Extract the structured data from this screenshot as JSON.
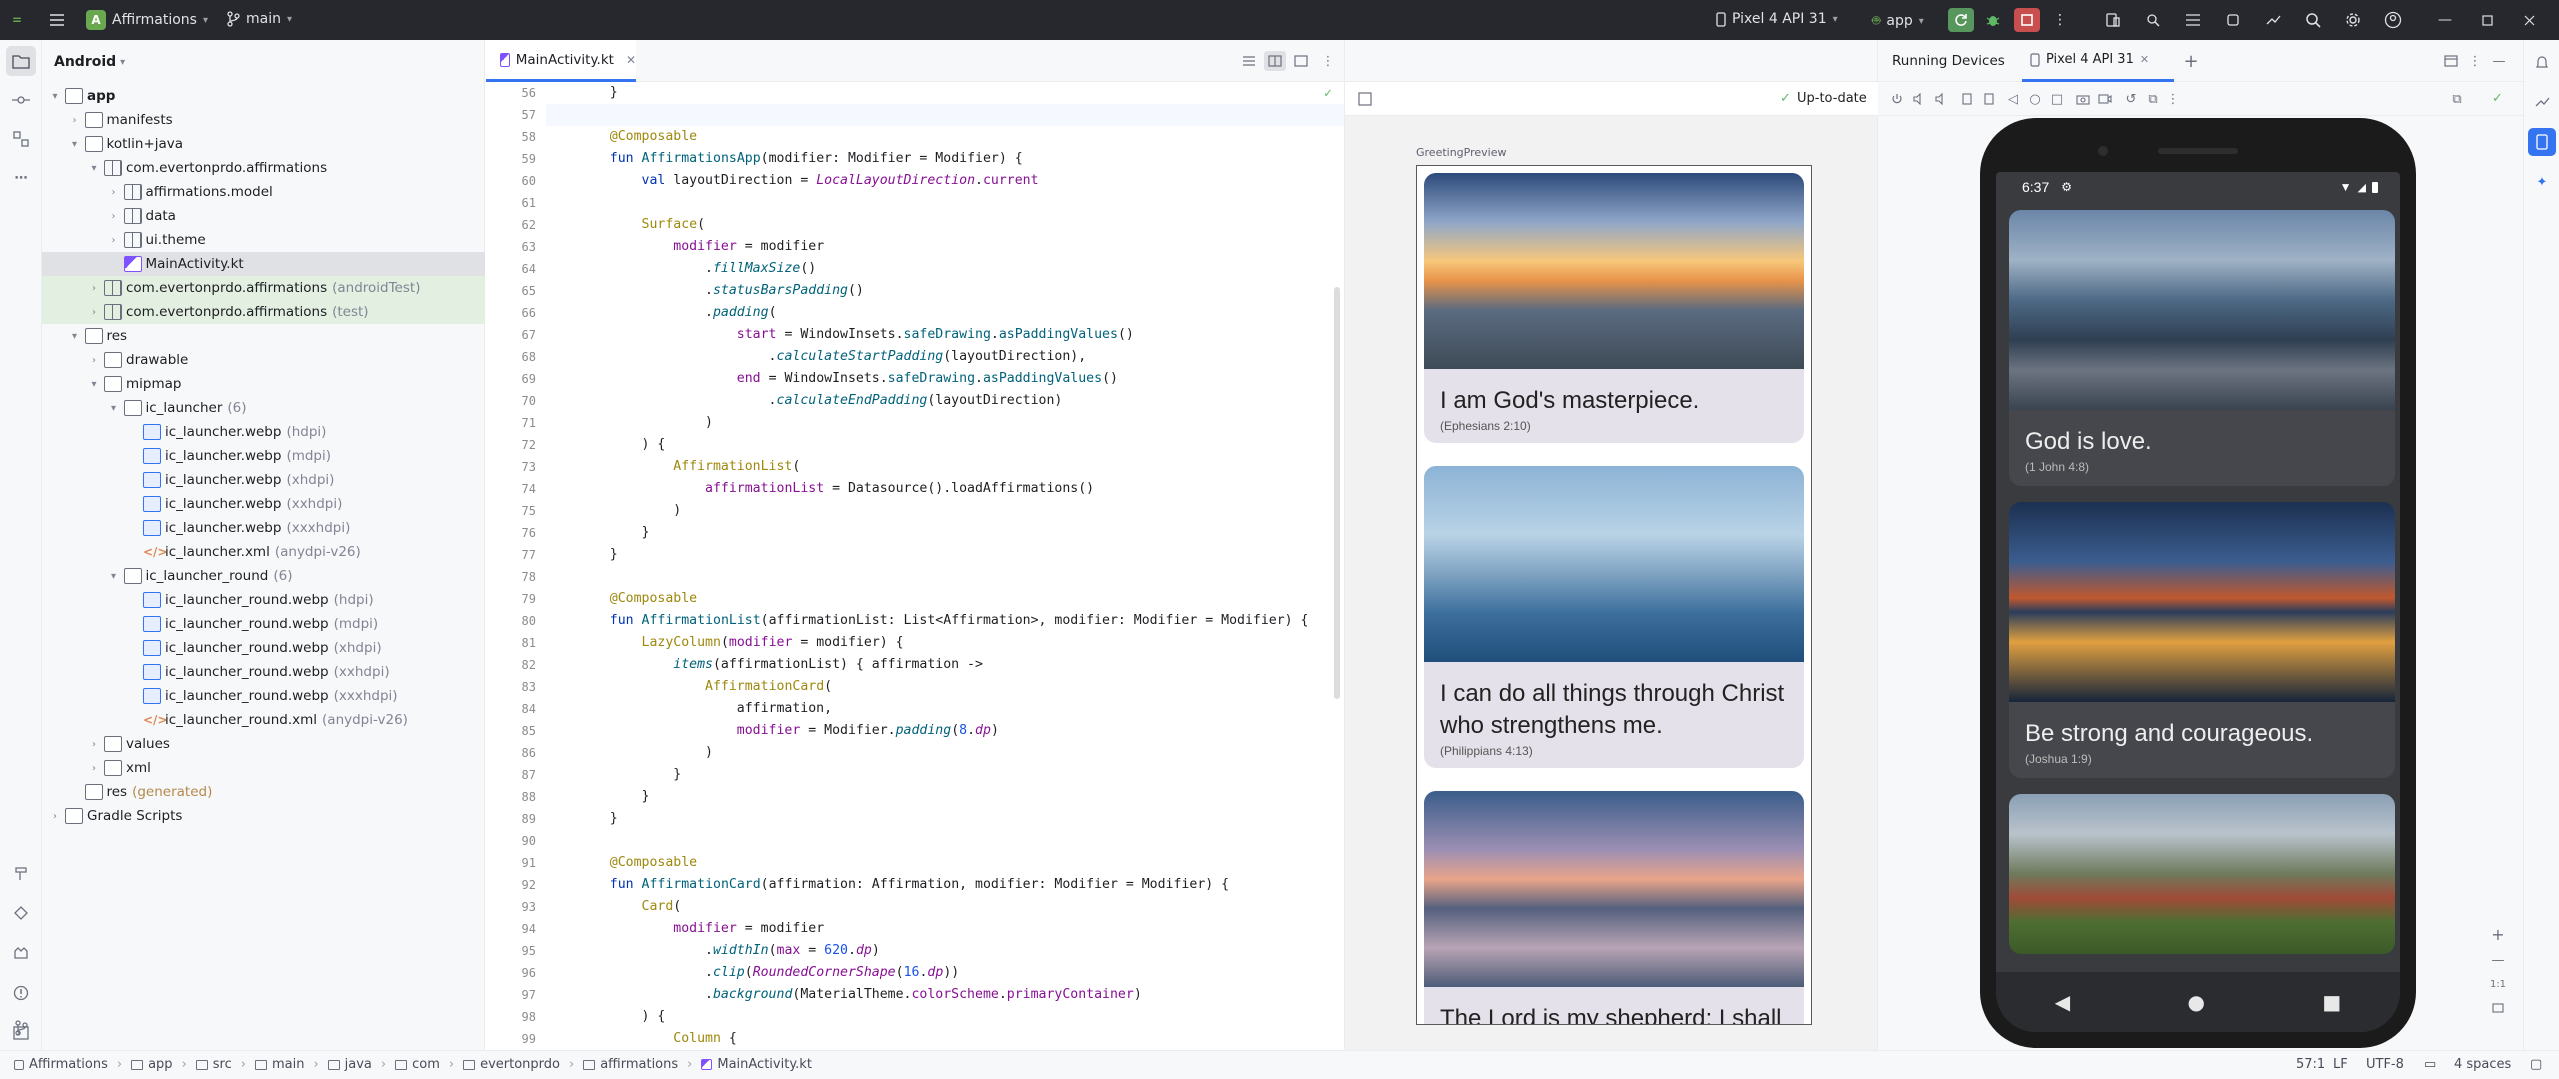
{
  "titlebar": {
    "project_initial": "A",
    "project": "Affirmations",
    "branch": "main",
    "device": "Pixel 4 API 31",
    "run_config": "app"
  },
  "project_view": {
    "mode": "Android",
    "tree": [
      {
        "label": "app",
        "suffix": "",
        "depth": 0,
        "arrow": "▾",
        "icon": "folder",
        "bold": true
      },
      {
        "label": "manifests",
        "suffix": "",
        "depth": 1,
        "arrow": "›",
        "icon": "folder"
      },
      {
        "label": "kotlin+java",
        "suffix": "",
        "depth": 1,
        "arrow": "▾",
        "icon": "folder"
      },
      {
        "label": "com.evertonprdo.affirmations",
        "suffix": "",
        "depth": 2,
        "arrow": "▾",
        "icon": "pkg"
      },
      {
        "label": "affirmations.model",
        "suffix": "",
        "depth": 3,
        "arrow": "›",
        "icon": "pkg"
      },
      {
        "label": "data",
        "suffix": "",
        "depth": 3,
        "arrow": "›",
        "icon": "pkg"
      },
      {
        "label": "ui.theme",
        "suffix": "",
        "depth": 3,
        "arrow": "›",
        "icon": "pkg"
      },
      {
        "label": "MainActivity.kt",
        "suffix": "",
        "depth": 3,
        "arrow": "",
        "icon": "kt",
        "selected": true
      },
      {
        "label": "com.evertonprdo.affirmations",
        "suffix": "(androidTest)",
        "depth": 2,
        "arrow": "›",
        "icon": "pkg",
        "green": true
      },
      {
        "label": "com.evertonprdo.affirmations",
        "suffix": "(test)",
        "depth": 2,
        "arrow": "›",
        "icon": "pkg",
        "green": true
      },
      {
        "label": "res",
        "suffix": "",
        "depth": 1,
        "arrow": "▾",
        "icon": "folder"
      },
      {
        "label": "drawable",
        "suffix": "",
        "depth": 2,
        "arrow": "›",
        "icon": "folder"
      },
      {
        "label": "mipmap",
        "suffix": "",
        "depth": 2,
        "arrow": "▾",
        "icon": "folder"
      },
      {
        "label": "ic_launcher",
        "suffix": "(6)",
        "depth": 3,
        "arrow": "▾",
        "icon": "folder"
      },
      {
        "label": "ic_launcher.webp",
        "suffix": "(hdpi)",
        "depth": 4,
        "arrow": "",
        "icon": "webp"
      },
      {
        "label": "ic_launcher.webp",
        "suffix": "(mdpi)",
        "depth": 4,
        "arrow": "",
        "icon": "webp"
      },
      {
        "label": "ic_launcher.webp",
        "suffix": "(xhdpi)",
        "depth": 4,
        "arrow": "",
        "icon": "webp"
      },
      {
        "label": "ic_launcher.webp",
        "suffix": "(xxhdpi)",
        "depth": 4,
        "arrow": "",
        "icon": "webp"
      },
      {
        "label": "ic_launcher.webp",
        "suffix": "(xxxhdpi)",
        "depth": 4,
        "arrow": "",
        "icon": "webp"
      },
      {
        "label": "ic_launcher.xml",
        "suffix": "(anydpi-v26)",
        "depth": 4,
        "arrow": "",
        "icon": "xml"
      },
      {
        "label": "ic_launcher_round",
        "suffix": "(6)",
        "depth": 3,
        "arrow": "▾",
        "icon": "folder"
      },
      {
        "label": "ic_launcher_round.webp",
        "suffix": "(hdpi)",
        "depth": 4,
        "arrow": "",
        "icon": "webp"
      },
      {
        "label": "ic_launcher_round.webp",
        "suffix": "(mdpi)",
        "depth": 4,
        "arrow": "",
        "icon": "webp"
      },
      {
        "label": "ic_launcher_round.webp",
        "suffix": "(xhdpi)",
        "depth": 4,
        "arrow": "",
        "icon": "webp"
      },
      {
        "label": "ic_launcher_round.webp",
        "suffix": "(xxhdpi)",
        "depth": 4,
        "arrow": "",
        "icon": "webp"
      },
      {
        "label": "ic_launcher_round.webp",
        "suffix": "(xxxhdpi)",
        "depth": 4,
        "arrow": "",
        "icon": "webp"
      },
      {
        "label": "ic_launcher_round.xml",
        "suffix": "(anydpi-v26)",
        "depth": 4,
        "arrow": "",
        "icon": "xml"
      },
      {
        "label": "values",
        "suffix": "",
        "depth": 2,
        "arrow": "›",
        "icon": "folder"
      },
      {
        "label": "xml",
        "suffix": "",
        "depth": 2,
        "arrow": "›",
        "icon": "folder"
      },
      {
        "label": "res",
        "suffix": "(generated)",
        "depth": 1,
        "arrow": "",
        "icon": "folder"
      },
      {
        "label": "Gradle Scripts",
        "suffix": "",
        "depth": 0,
        "arrow": "›",
        "icon": "gradle"
      }
    ]
  },
  "editor": {
    "tab": "MainActivity.kt",
    "lines": [
      {
        "n": "56",
        "html": "    }"
      },
      {
        "n": "57",
        "html": ""
      },
      {
        "n": "58",
        "html": "    <span class=\"an\">@Composable</span>"
      },
      {
        "n": "59",
        "html": "    <span class=\"kw\">fun</span> <span class=\"fn\">AffirmationsApp</span>(modifier: Modifier = Modifier) {"
      },
      {
        "n": "60",
        "html": "        <span class=\"kw\">val</span> layoutDirection = <span class=\"pp\">LocalLayoutDirection</span>.<span class=\"nm2\">current</span>"
      },
      {
        "n": "61",
        "html": ""
      },
      {
        "n": "62",
        "html": "        <span class=\"an\">Surface</span>("
      },
      {
        "n": "63",
        "html": "            <span class=\"pm\">modifier</span> = modifier"
      },
      {
        "n": "64",
        "html": "                .<span class=\"it\">fillMaxSize</span>()"
      },
      {
        "n": "65",
        "html": "                .<span class=\"it\">statusBarsPadding</span>()"
      },
      {
        "n": "66",
        "html": "                .<span class=\"it\">padding</span>("
      },
      {
        "n": "67",
        "html": "                    <span class=\"pm\">start</span> = WindowInsets.<span class=\"fn\">safeDrawing</span>.<span class=\"fn\">asPaddingValues</span>()"
      },
      {
        "n": "68",
        "html": "                        .<span class=\"it\">calculateStartPadding</span>(layoutDirection),"
      },
      {
        "n": "69",
        "html": "                    <span class=\"pm\">end</span> = WindowInsets.<span class=\"fn\">safeDrawing</span>.<span class=\"fn\">asPaddingValues</span>()"
      },
      {
        "n": "70",
        "html": "                        .<span class=\"it\">calculateEndPadding</span>(layoutDirection)"
      },
      {
        "n": "71",
        "html": "                )"
      },
      {
        "n": "72",
        "html": "        ) {"
      },
      {
        "n": "73",
        "html": "            <span class=\"an\">AffirmationList</span>("
      },
      {
        "n": "74",
        "html": "                <span class=\"pm\">affirmationList</span> = Datasource().loadAffirmations()"
      },
      {
        "n": "75",
        "html": "            )"
      },
      {
        "n": "76",
        "html": "        }"
      },
      {
        "n": "77",
        "html": "    }"
      },
      {
        "n": "78",
        "html": ""
      },
      {
        "n": "79",
        "html": "    <span class=\"an\">@Composable</span>"
      },
      {
        "n": "80",
        "html": "    <span class=\"kw\">fun</span> <span class=\"fn\">AffirmationList</span>(affirmationList: List&lt;Affirmation&gt;, modifier: Modifier = Modifier) {"
      },
      {
        "n": "81",
        "html": "        <span class=\"an\">LazyColumn</span>(<span class=\"pm\">modifier</span> = modifier) {"
      },
      {
        "n": "82",
        "html": "            <span class=\"it\">items</span>(affirmationList) { affirmation -&gt;"
      },
      {
        "n": "83",
        "html": "                <span class=\"an\">AffirmationCard</span>("
      },
      {
        "n": "84",
        "html": "                    affirmation,"
      },
      {
        "n": "85",
        "html": "                    <span class=\"pm\">modifier</span> = Modifier.<span class=\"it\">padding</span>(<span class=\"nm\">8</span>.<span class=\"pp\">dp</span>)"
      },
      {
        "n": "86",
        "html": "                )"
      },
      {
        "n": "87",
        "html": "            }"
      },
      {
        "n": "88",
        "html": "        }"
      },
      {
        "n": "89",
        "html": "    }"
      },
      {
        "n": "90",
        "html": ""
      },
      {
        "n": "91",
        "html": "    <span class=\"an\">@Composable</span>"
      },
      {
        "n": "92",
        "html": "    <span class=\"kw\">fun</span> <span class=\"fn\">AffirmationCard</span>(affirmation: Affirmation, modifier: Modifier = Modifier) {"
      },
      {
        "n": "93",
        "html": "        <span class=\"an\">Card</span>("
      },
      {
        "n": "94",
        "html": "            <span class=\"pm\">modifier</span> = modifier"
      },
      {
        "n": "95",
        "html": "                .<span class=\"it\">widthIn</span>(<span class=\"pm\">max</span> = <span class=\"nm\">620</span>.<span class=\"pp\">dp</span>)"
      },
      {
        "n": "96",
        "html": "                .<span class=\"it\">clip</span>(<span class=\"pp\">RoundedCornerShape</span>(<span class=\"nm\">16</span>.<span class=\"pp\">dp</span>))"
      },
      {
        "n": "97",
        "html": "                .<span class=\"it\">background</span>(MaterialTheme.<span class=\"nm2\">colorScheme</span>.<span class=\"nm2\">primaryContainer</span>)"
      },
      {
        "n": "98",
        "html": "        ) {"
      },
      {
        "n": "99",
        "html": "            <span class=\"an\">Column</span> {"
      }
    ]
  },
  "preview": {
    "status": "Up-to-date",
    "name": "GreetingPreview",
    "cards": [
      {
        "title": "I am God's masterpiece.",
        "ref": "(Ephesians 2:10)"
      },
      {
        "title": "I can do all things through Christ who strengthens me.",
        "ref": "(Philippians 4:13)"
      },
      {
        "title": "The Lord is my shepherd; I shall",
        "ref": ""
      }
    ]
  },
  "devices": {
    "title": "Running Devices",
    "tab": "Pixel 4 API 31",
    "time": "6:37",
    "cards": [
      {
        "title": "God is love.",
        "ref": "(1 John 4:8)"
      },
      {
        "title": "Be strong and courageous.",
        "ref": "(Joshua 1:9)"
      },
      {
        "title": "",
        "ref": ""
      }
    ],
    "zoom_ratio": "1:1"
  },
  "statusbar": {
    "crumbs": [
      "Affirmations",
      "app",
      "src",
      "main",
      "java",
      "com",
      "evertonprdo",
      "affirmations",
      "MainActivity.kt"
    ],
    "position": "57:1",
    "line_sep": "LF",
    "encoding": "UTF-8",
    "indent": "4 spaces"
  }
}
